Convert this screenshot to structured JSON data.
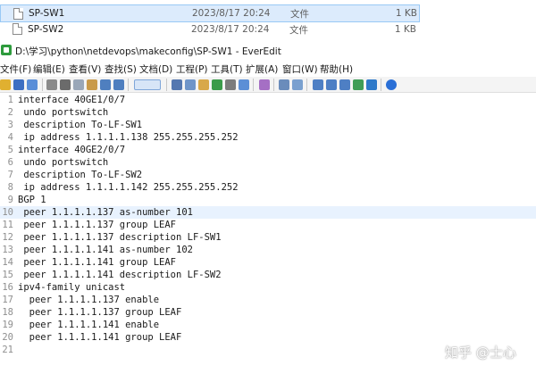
{
  "explorer": {
    "files": [
      {
        "name": "SP-SW1",
        "date": "2023/8/17 20:24",
        "type": "文件",
        "size": "1 KB",
        "selected": true
      },
      {
        "name": "SP-SW2",
        "date": "2023/8/17 20:24",
        "type": "文件",
        "size": "1 KB",
        "selected": false
      }
    ]
  },
  "window": {
    "title": "D:\\学习\\python\\netdevops\\makeconfig\\SP-SW1 - EverEdit"
  },
  "menu": [
    "文件(F)",
    "编辑(E)",
    "查看(V)",
    "查找(S)",
    "文档(D)",
    "工程(P)",
    "工具(T)",
    "扩展(A)",
    "窗口(W)",
    "帮助(H)"
  ],
  "toolbar": {
    "icons": [
      "open-icon",
      "save-icon",
      "save-all-icon",
      "cut-icon",
      "copy-icon",
      "paste-icon",
      "undo-icon",
      "redo-icon",
      "format-icon",
      "find-icon",
      "replace-icon",
      "find-in-files-icon",
      "bookmark-icon",
      "macro-icon",
      "run-icon",
      "wrap-icon",
      "whitespace-icon",
      "columns-icon",
      "preview-icon",
      "help-icon"
    ],
    "accent": "#2a6fd6"
  },
  "editor": {
    "current_line": 10,
    "lines": [
      "interface 40GE1/0/7",
      " undo portswitch",
      " description To-LF-SW1",
      " ip address 1.1.1.1.138 255.255.255.252",
      "interface 40GE2/0/7",
      " undo portswitch",
      " description To-LF-SW2",
      " ip address 1.1.1.1.142 255.255.255.252",
      "BGP 1",
      " peer 1.1.1.1.137 as-number 101",
      " peer 1.1.1.1.137 group LEAF",
      " peer 1.1.1.1.137 description LF-SW1",
      " peer 1.1.1.1.141 as-number 102",
      " peer 1.1.1.1.141 group LEAF",
      " peer 1.1.1.1.141 description LF-SW2",
      "ipv4-family unicast",
      "  peer 1.1.1.1.137 enable",
      "  peer 1.1.1.1.137 group LEAF",
      "  peer 1.1.1.1.141 enable",
      "  peer 1.1.1.1.141 group LEAF",
      ""
    ]
  },
  "watermark": "知乎 @士心"
}
